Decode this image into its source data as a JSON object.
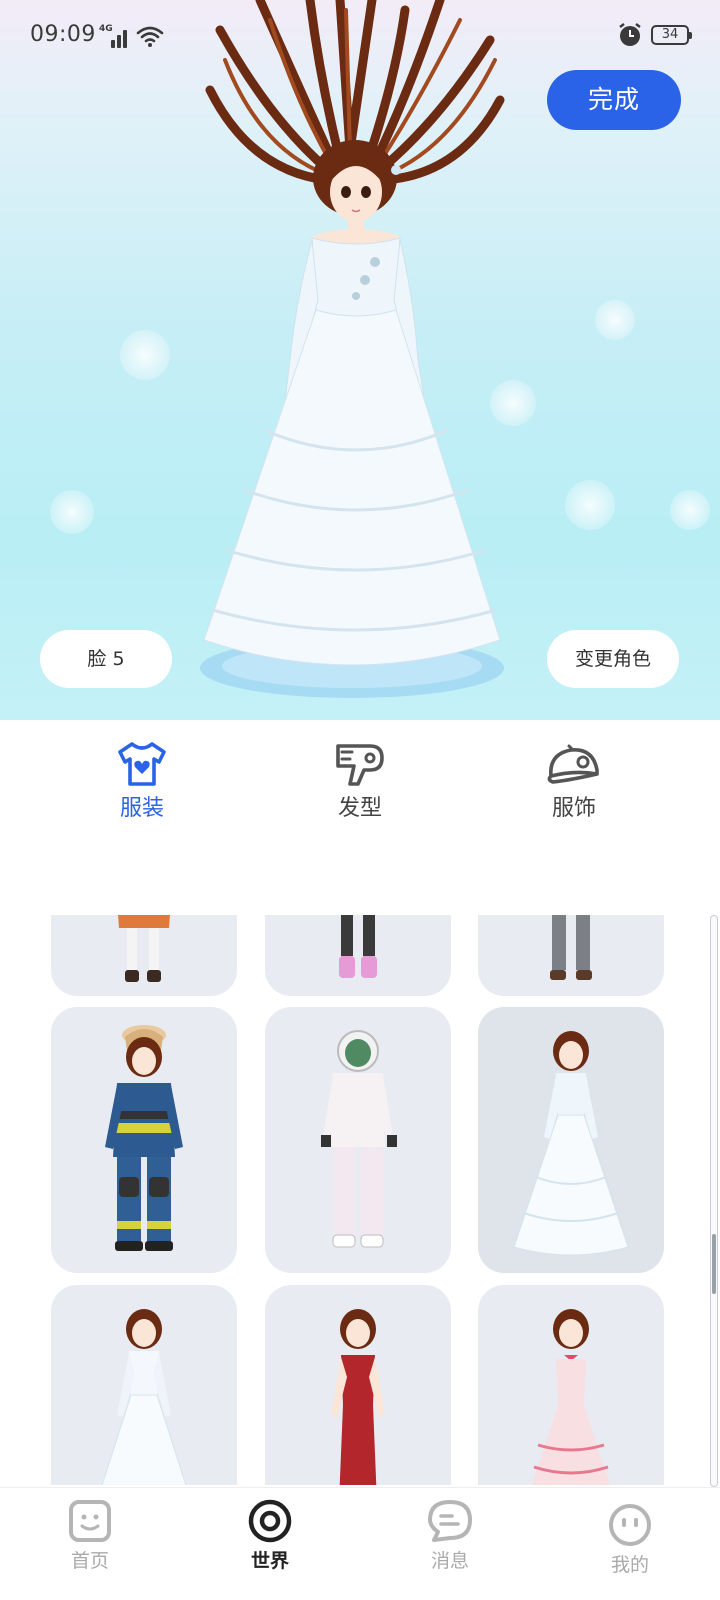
{
  "status_bar": {
    "time": "09:09",
    "network": "4G",
    "battery": "34"
  },
  "header": {
    "done_label": "完成"
  },
  "preview": {
    "face_label": "脸 5",
    "change_character_label": "变更角色"
  },
  "categories": [
    {
      "label": "服装",
      "icon": "tshirt-heart-icon",
      "active": true
    },
    {
      "label": "发型",
      "icon": "hair-dryer-icon",
      "active": false
    },
    {
      "label": "服饰",
      "icon": "cap-icon",
      "active": false
    }
  ],
  "outfits": [
    {
      "icon": "outfit-orange-skirt-icon",
      "selected": false
    },
    {
      "icon": "outfit-black-pants-pink-shoes-icon",
      "selected": false
    },
    {
      "icon": "outfit-grey-pants-icon",
      "selected": false
    },
    {
      "icon": "outfit-firefighter-icon",
      "selected": false
    },
    {
      "icon": "outfit-astronaut-icon",
      "selected": false
    },
    {
      "icon": "outfit-white-layered-gown-icon",
      "selected": true
    },
    {
      "icon": "outfit-white-wedding-dress-icon",
      "selected": false
    },
    {
      "icon": "outfit-red-evening-gown-icon",
      "selected": false
    },
    {
      "icon": "outfit-pink-ruffle-dress-icon",
      "selected": false
    }
  ],
  "nav": [
    {
      "label": "首页",
      "icon": "home-face-icon",
      "active": false
    },
    {
      "label": "世界",
      "icon": "world-ring-icon",
      "active": true
    },
    {
      "label": "消息",
      "icon": "message-bubble-icon",
      "active": false
    },
    {
      "label": "我的",
      "icon": "profile-face-icon",
      "active": false
    }
  ],
  "colors": {
    "accent": "#2a63e8",
    "card_bg": "#e8ecf2",
    "sky_top": "#f3ecf7",
    "sky_bottom": "#b9eef5"
  }
}
